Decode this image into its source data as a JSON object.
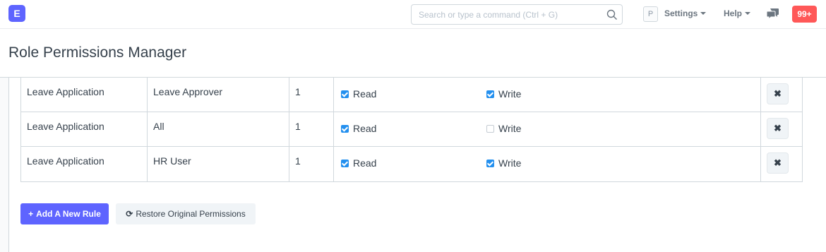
{
  "navbar": {
    "logo_letter": "E",
    "search_placeholder": "Search or type a command (Ctrl + G)",
    "avatar_letter": "P",
    "settings_label": "Settings",
    "help_label": "Help",
    "notifications_count": "99+"
  },
  "page": {
    "title": "Role Permissions Manager"
  },
  "rules": [
    {
      "document_type": "Leave Application",
      "role": "Leave Approver",
      "level": "1",
      "read_label": "Read",
      "read_checked": true,
      "write_label": "Write",
      "write_checked": true
    },
    {
      "document_type": "Leave Application",
      "role": "All",
      "level": "1",
      "read_label": "Read",
      "read_checked": true,
      "write_label": "Write",
      "write_checked": false
    },
    {
      "document_type": "Leave Application",
      "role": "HR User",
      "level": "1",
      "read_label": "Read",
      "read_checked": true,
      "write_label": "Write",
      "write_checked": true
    }
  ],
  "actions": {
    "add_rule_label": "Add A New Rule",
    "restore_label": "Restore Original Permissions",
    "delete_glyph": "✖"
  },
  "colors": {
    "primary": "#5e64ff",
    "checkbox": "#2490ef",
    "badge": "#ff5858"
  }
}
